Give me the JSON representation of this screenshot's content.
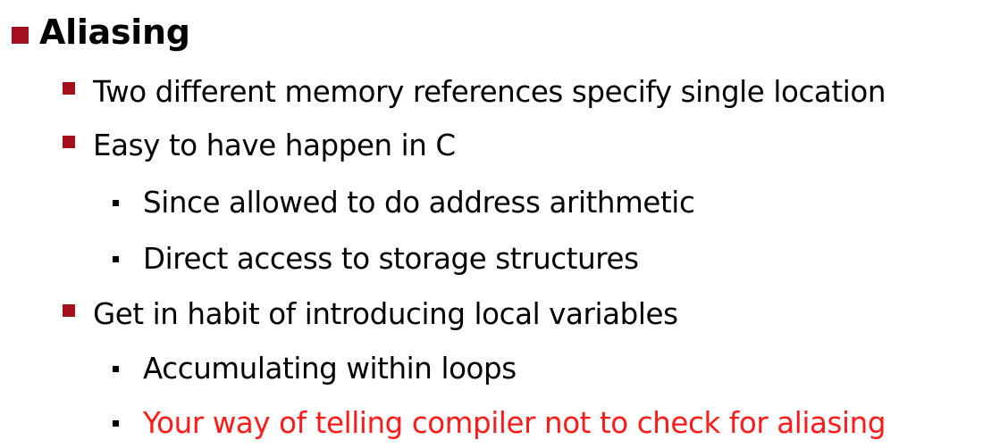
{
  "slide": {
    "heading": "Aliasing",
    "items": [
      {
        "level": 1,
        "text": "Two different memory references specify single location"
      },
      {
        "level": 1,
        "text": "Easy to have happen in C"
      },
      {
        "level": 2,
        "text": "Since allowed to do address arithmetic"
      },
      {
        "level": 2,
        "text": "Direct access to storage structures"
      },
      {
        "level": 1,
        "text": "Get in habit of introducing local variables"
      },
      {
        "level": 2,
        "text": "Accumulating within loops"
      },
      {
        "level": 2,
        "text": "Your way of telling compiler not to check for aliasing",
        "color": "#ff1a1a"
      }
    ]
  },
  "colors": {
    "heading_bullet": "#a50e1b",
    "level1_bullet": "#a50e1b",
    "level2_bullet": "#000000",
    "highlight_text": "#ff1a1a"
  }
}
